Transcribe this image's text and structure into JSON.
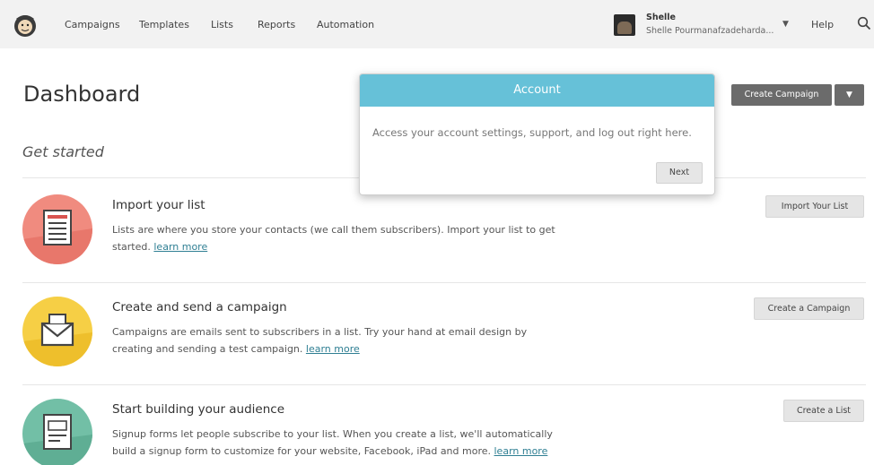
{
  "nav": {
    "items": [
      "Campaigns",
      "Templates",
      "Lists",
      "Reports",
      "Automation"
    ],
    "user_name": "Shelle",
    "user_full": "Shelle Pourmanafzadeharda...",
    "help": "Help"
  },
  "page": {
    "title": "Dashboard",
    "subtitle": "Get started",
    "create_campaign": "Create Campaign"
  },
  "popover": {
    "title": "Account",
    "body": "Access your account settings, support, and log out right here.",
    "next": "Next"
  },
  "tasks": [
    {
      "title": "Import your list",
      "desc": "Lists are where you store your contacts (we call them subscribers). Import your list to get started.",
      "learn": "learn more",
      "button": "Import Your List"
    },
    {
      "title": "Create and send a campaign",
      "desc": "Campaigns are emails sent to subscribers in a list. Try your hand at email design by creating and sending a test campaign.",
      "learn": "learn more",
      "button": "Create a Campaign"
    },
    {
      "title": "Start building your audience",
      "desc": "Signup forms let people subscribe to your list. When you create a list, we'll automatically build a signup form to customize for your website, Facebook, iPad and more.",
      "learn": "learn more",
      "button": "Create a List"
    }
  ],
  "colors": {
    "popover_header": "#66c1d8",
    "import_circle": "#f08b7f",
    "campaign_circle": "#f6cf45",
    "audience_circle": "#72bfa6",
    "link": "#2f7f93"
  },
  "icons": [
    "mailchimp-logo",
    "search-icon",
    "chevron-down-icon",
    "list-icon",
    "envelope-icon",
    "form-icon"
  ]
}
